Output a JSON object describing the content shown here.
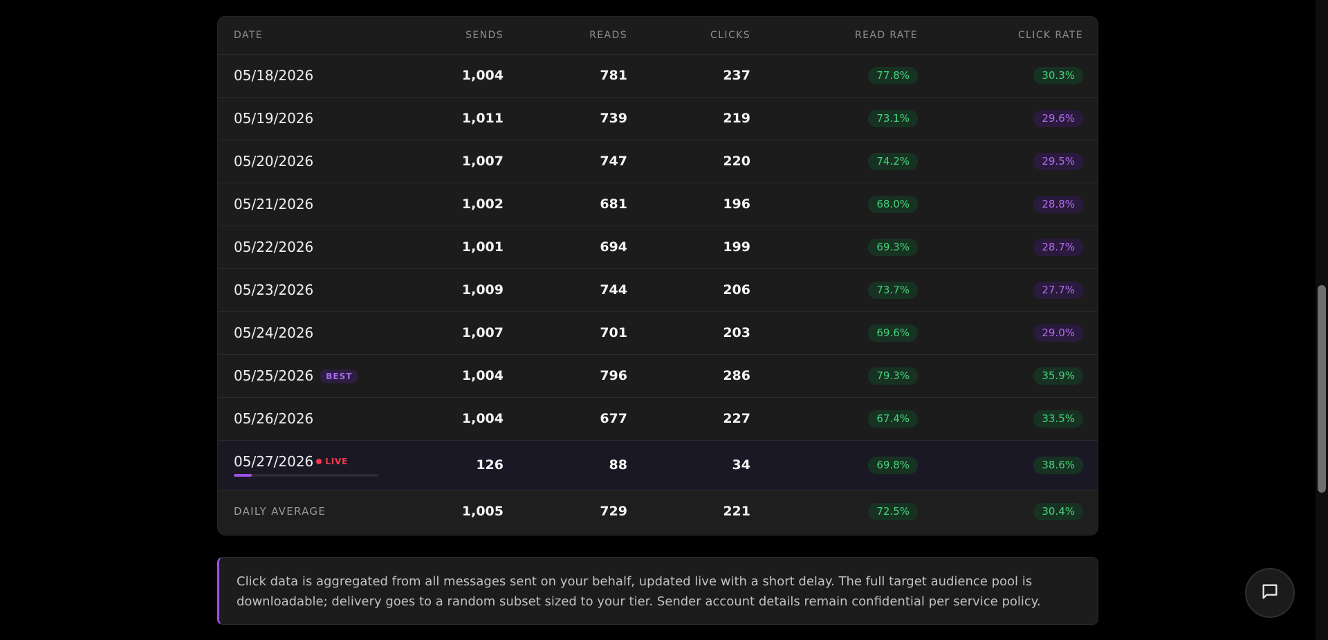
{
  "table": {
    "headers": {
      "date": "DATE",
      "sends": "SENDS",
      "reads": "READS",
      "clicks": "CLICKS",
      "read_rate": "READ RATE",
      "click_rate": "CLICK RATE"
    },
    "rows": [
      {
        "date": "05/18/2026",
        "sends": "1,004",
        "reads": "781",
        "clicks": "237",
        "read_rate": "77.8%",
        "click_rate": "30.3%",
        "click_rate_color": "green"
      },
      {
        "date": "05/19/2026",
        "sends": "1,011",
        "reads": "739",
        "clicks": "219",
        "read_rate": "73.1%",
        "click_rate": "29.6%",
        "click_rate_color": "purple"
      },
      {
        "date": "05/20/2026",
        "sends": "1,007",
        "reads": "747",
        "clicks": "220",
        "read_rate": "74.2%",
        "click_rate": "29.5%",
        "click_rate_color": "purple"
      },
      {
        "date": "05/21/2026",
        "sends": "1,002",
        "reads": "681",
        "clicks": "196",
        "read_rate": "68.0%",
        "click_rate": "28.8%",
        "click_rate_color": "purple"
      },
      {
        "date": "05/22/2026",
        "sends": "1,001",
        "reads": "694",
        "clicks": "199",
        "read_rate": "69.3%",
        "click_rate": "28.7%",
        "click_rate_color": "purple"
      },
      {
        "date": "05/23/2026",
        "sends": "1,009",
        "reads": "744",
        "clicks": "206",
        "read_rate": "73.7%",
        "click_rate": "27.7%",
        "click_rate_color": "purple"
      },
      {
        "date": "05/24/2026",
        "sends": "1,007",
        "reads": "701",
        "clicks": "203",
        "read_rate": "69.6%",
        "click_rate": "29.0%",
        "click_rate_color": "purple"
      },
      {
        "date": "05/25/2026",
        "badge": "BEST",
        "sends": "1,004",
        "reads": "796",
        "clicks": "286",
        "read_rate": "79.3%",
        "click_rate": "35.9%",
        "click_rate_color": "green"
      },
      {
        "date": "05/26/2026",
        "sends": "1,004",
        "reads": "677",
        "clicks": "227",
        "read_rate": "67.4%",
        "click_rate": "33.5%",
        "click_rate_color": "green"
      }
    ],
    "live_row": {
      "date": "05/27/2026",
      "live_label": "LIVE",
      "progress_fraction": 0.126,
      "sends": "126",
      "reads": "88",
      "clicks": "34",
      "read_rate": "69.8%",
      "click_rate": "38.6%"
    },
    "average_row": {
      "label": "DAILY AVERAGE",
      "sends": "1,005",
      "reads": "729",
      "clicks": "221",
      "read_rate": "72.5%",
      "click_rate": "30.4%"
    }
  },
  "notice": {
    "text": "Click data is aggregated from all messages sent on your behalf, updated live with a short delay. The full target audience pool is downloadable; delivery goes to a random subset sized to your tier. Sender account details remain confidential per service policy."
  },
  "chat_button": {
    "icon": "chat-bubble-icon"
  },
  "colors": {
    "accent_purple": "#9b52e8",
    "good_green": "#46d27b",
    "live_red": "#ef3a4e"
  }
}
